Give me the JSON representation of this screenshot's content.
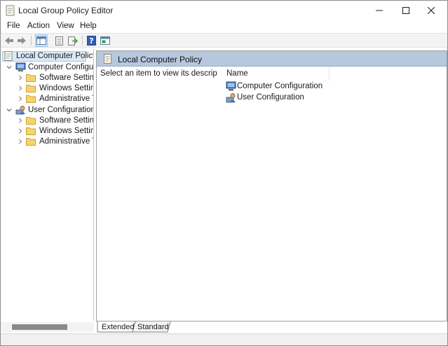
{
  "window": {
    "title": "Local Group Policy Editor"
  },
  "menu": {
    "items": [
      "File",
      "Action",
      "View",
      "Help"
    ]
  },
  "toolbar": {
    "buttons": [
      "back-icon",
      "forward-icon",
      "show-hide-tree-icon",
      "properties-icon",
      "export-list-icon",
      "help-icon",
      "show-hide-action-pane-icon"
    ]
  },
  "tree": {
    "root": {
      "label": "Local Computer Policy",
      "selected": true
    },
    "nodes": [
      {
        "label": "Computer Configurati",
        "expanded": true,
        "children": [
          "Software Settings",
          "Windows Settings",
          "Administrative Te"
        ]
      },
      {
        "label": "User Configuration",
        "expanded": true,
        "children": [
          "Software Settings",
          "Windows Settings",
          "Administrative Te"
        ]
      }
    ]
  },
  "details": {
    "header_title": "Local Computer Policy",
    "description": "Select an item to view its description.",
    "column_name": "Name",
    "items": [
      "Computer Configuration",
      "User Configuration"
    ]
  },
  "tabs": {
    "extended": "Extended",
    "standard": "Standard",
    "active": "Extended"
  },
  "colors": {
    "header_blue": "#b6c8de",
    "selection_blue": "#dbe9f6",
    "folder_yellow": "#f6d36b",
    "help_blue": "#2f5fb8"
  }
}
